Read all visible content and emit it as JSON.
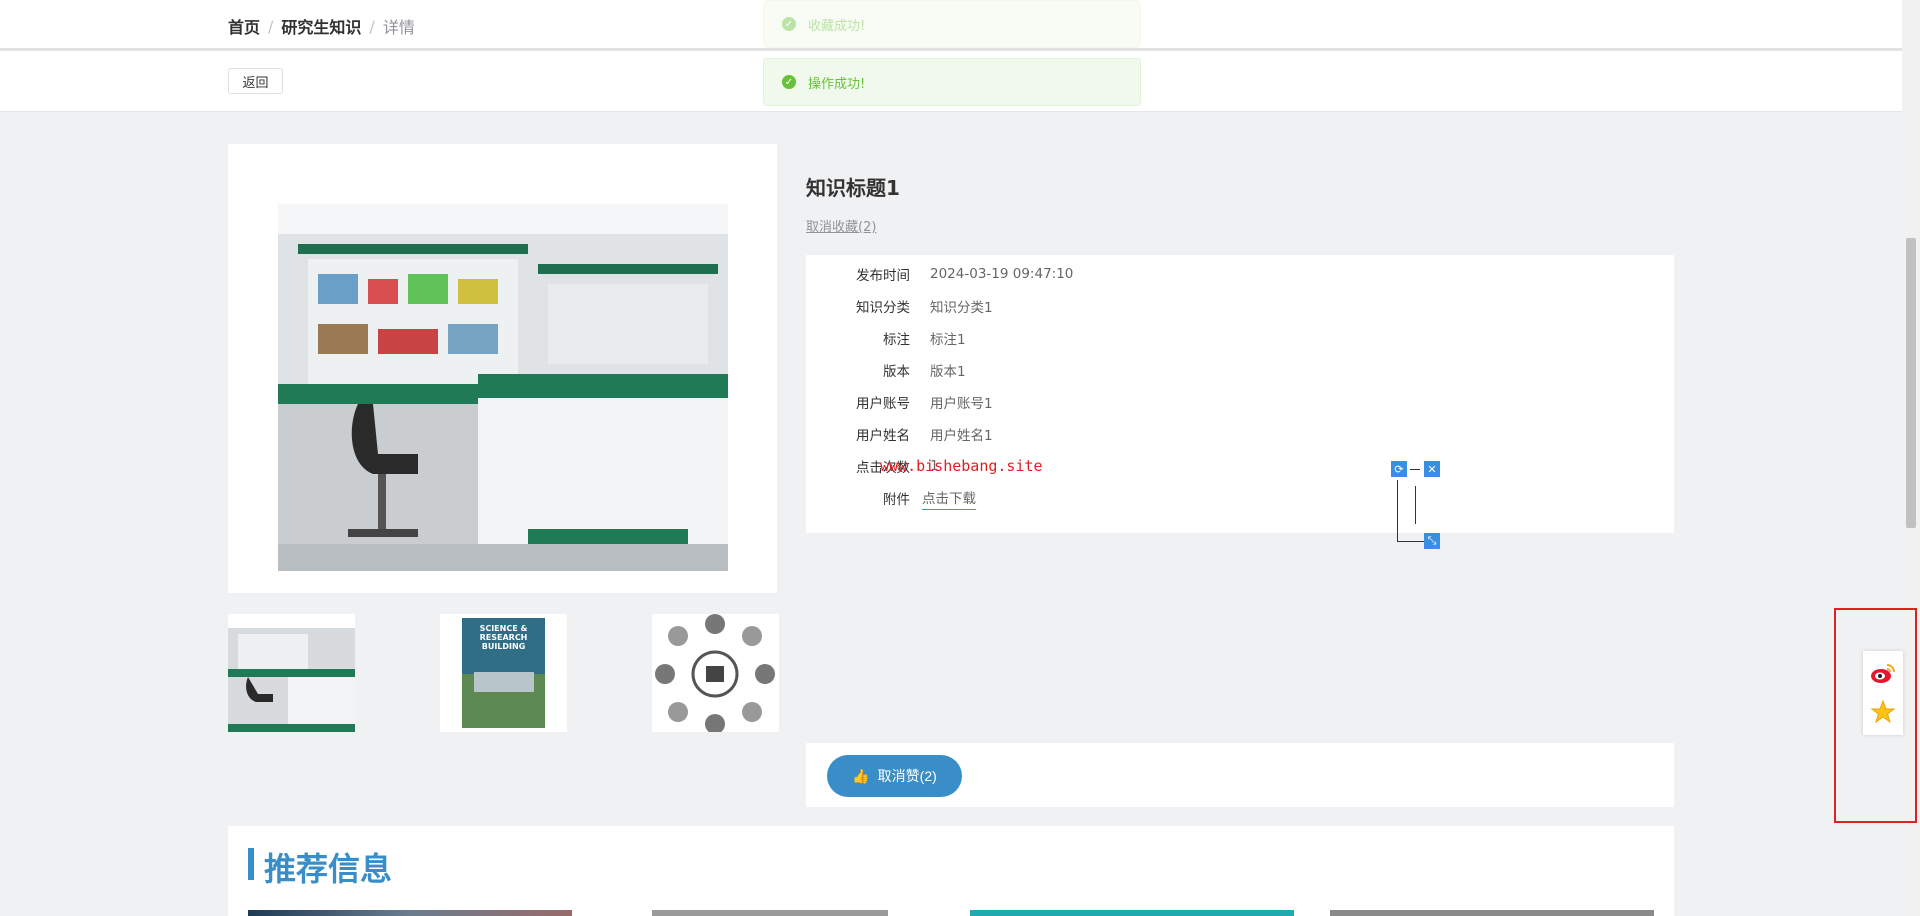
{
  "breadcrumb": {
    "home": "首页",
    "section": "研究生知识",
    "current": "详情",
    "sep": "/"
  },
  "toolbar": {
    "back_label": "返回"
  },
  "toasts": [
    {
      "text": "收藏成功!"
    },
    {
      "text": "操作成功!"
    }
  ],
  "detail": {
    "title": "知识标题1",
    "collect_link": "取消收藏(2)",
    "fields": [
      {
        "label": "发布时间",
        "value": "2024-03-19 09:47:10"
      },
      {
        "label": "知识分类",
        "value": "知识分类1"
      },
      {
        "label": "标注",
        "value": "标注1"
      },
      {
        "label": "版本",
        "value": "版本1"
      },
      {
        "label": "用户账号",
        "value": "用户账号1"
      },
      {
        "label": "用户姓名",
        "value": "用户姓名1"
      },
      {
        "label": "点击次数",
        "value": "1"
      },
      {
        "label": "附件",
        "value": "点击下载"
      }
    ],
    "watermark": "www.bishebang.site"
  },
  "thumbs": [
    {
      "caption": "SCIENCE & RESEARCH BUILDING"
    }
  ],
  "like": {
    "label": "取消赞(2)"
  },
  "recommend": {
    "title": "推荐信息"
  },
  "colors": {
    "accent": "#3a8ec8",
    "success": "#67c23a",
    "highlight": "#e02020"
  }
}
